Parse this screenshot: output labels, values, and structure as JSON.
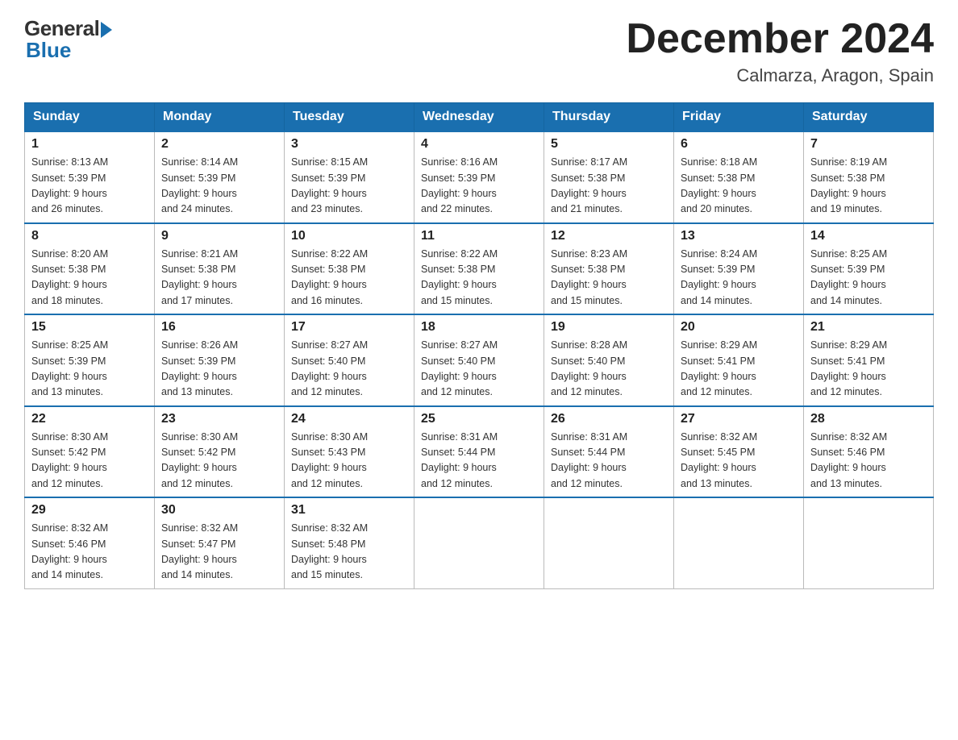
{
  "header": {
    "logo_general": "General",
    "logo_blue": "Blue",
    "month_title": "December 2024",
    "location": "Calmarza, Aragon, Spain"
  },
  "days_of_week": [
    "Sunday",
    "Monday",
    "Tuesday",
    "Wednesday",
    "Thursday",
    "Friday",
    "Saturday"
  ],
  "weeks": [
    [
      {
        "day": "1",
        "sunrise": "8:13 AM",
        "sunset": "5:39 PM",
        "daylight": "9 hours and 26 minutes."
      },
      {
        "day": "2",
        "sunrise": "8:14 AM",
        "sunset": "5:39 PM",
        "daylight": "9 hours and 24 minutes."
      },
      {
        "day": "3",
        "sunrise": "8:15 AM",
        "sunset": "5:39 PM",
        "daylight": "9 hours and 23 minutes."
      },
      {
        "day": "4",
        "sunrise": "8:16 AM",
        "sunset": "5:39 PM",
        "daylight": "9 hours and 22 minutes."
      },
      {
        "day": "5",
        "sunrise": "8:17 AM",
        "sunset": "5:38 PM",
        "daylight": "9 hours and 21 minutes."
      },
      {
        "day": "6",
        "sunrise": "8:18 AM",
        "sunset": "5:38 PM",
        "daylight": "9 hours and 20 minutes."
      },
      {
        "day": "7",
        "sunrise": "8:19 AM",
        "sunset": "5:38 PM",
        "daylight": "9 hours and 19 minutes."
      }
    ],
    [
      {
        "day": "8",
        "sunrise": "8:20 AM",
        "sunset": "5:38 PM",
        "daylight": "9 hours and 18 minutes."
      },
      {
        "day": "9",
        "sunrise": "8:21 AM",
        "sunset": "5:38 PM",
        "daylight": "9 hours and 17 minutes."
      },
      {
        "day": "10",
        "sunrise": "8:22 AM",
        "sunset": "5:38 PM",
        "daylight": "9 hours and 16 minutes."
      },
      {
        "day": "11",
        "sunrise": "8:22 AM",
        "sunset": "5:38 PM",
        "daylight": "9 hours and 15 minutes."
      },
      {
        "day": "12",
        "sunrise": "8:23 AM",
        "sunset": "5:38 PM",
        "daylight": "9 hours and 15 minutes."
      },
      {
        "day": "13",
        "sunrise": "8:24 AM",
        "sunset": "5:39 PM",
        "daylight": "9 hours and 14 minutes."
      },
      {
        "day": "14",
        "sunrise": "8:25 AM",
        "sunset": "5:39 PM",
        "daylight": "9 hours and 14 minutes."
      }
    ],
    [
      {
        "day": "15",
        "sunrise": "8:25 AM",
        "sunset": "5:39 PM",
        "daylight": "9 hours and 13 minutes."
      },
      {
        "day": "16",
        "sunrise": "8:26 AM",
        "sunset": "5:39 PM",
        "daylight": "9 hours and 13 minutes."
      },
      {
        "day": "17",
        "sunrise": "8:27 AM",
        "sunset": "5:40 PM",
        "daylight": "9 hours and 12 minutes."
      },
      {
        "day": "18",
        "sunrise": "8:27 AM",
        "sunset": "5:40 PM",
        "daylight": "9 hours and 12 minutes."
      },
      {
        "day": "19",
        "sunrise": "8:28 AM",
        "sunset": "5:40 PM",
        "daylight": "9 hours and 12 minutes."
      },
      {
        "day": "20",
        "sunrise": "8:29 AM",
        "sunset": "5:41 PM",
        "daylight": "9 hours and 12 minutes."
      },
      {
        "day": "21",
        "sunrise": "8:29 AM",
        "sunset": "5:41 PM",
        "daylight": "9 hours and 12 minutes."
      }
    ],
    [
      {
        "day": "22",
        "sunrise": "8:30 AM",
        "sunset": "5:42 PM",
        "daylight": "9 hours and 12 minutes."
      },
      {
        "day": "23",
        "sunrise": "8:30 AM",
        "sunset": "5:42 PM",
        "daylight": "9 hours and 12 minutes."
      },
      {
        "day": "24",
        "sunrise": "8:30 AM",
        "sunset": "5:43 PM",
        "daylight": "9 hours and 12 minutes."
      },
      {
        "day": "25",
        "sunrise": "8:31 AM",
        "sunset": "5:44 PM",
        "daylight": "9 hours and 12 minutes."
      },
      {
        "day": "26",
        "sunrise": "8:31 AM",
        "sunset": "5:44 PM",
        "daylight": "9 hours and 12 minutes."
      },
      {
        "day": "27",
        "sunrise": "8:32 AM",
        "sunset": "5:45 PM",
        "daylight": "9 hours and 13 minutes."
      },
      {
        "day": "28",
        "sunrise": "8:32 AM",
        "sunset": "5:46 PM",
        "daylight": "9 hours and 13 minutes."
      }
    ],
    [
      {
        "day": "29",
        "sunrise": "8:32 AM",
        "sunset": "5:46 PM",
        "daylight": "9 hours and 14 minutes."
      },
      {
        "day": "30",
        "sunrise": "8:32 AM",
        "sunset": "5:47 PM",
        "daylight": "9 hours and 14 minutes."
      },
      {
        "day": "31",
        "sunrise": "8:32 AM",
        "sunset": "5:48 PM",
        "daylight": "9 hours and 15 minutes."
      },
      null,
      null,
      null,
      null
    ]
  ],
  "labels": {
    "sunrise": "Sunrise:",
    "sunset": "Sunset:",
    "daylight": "Daylight:"
  }
}
